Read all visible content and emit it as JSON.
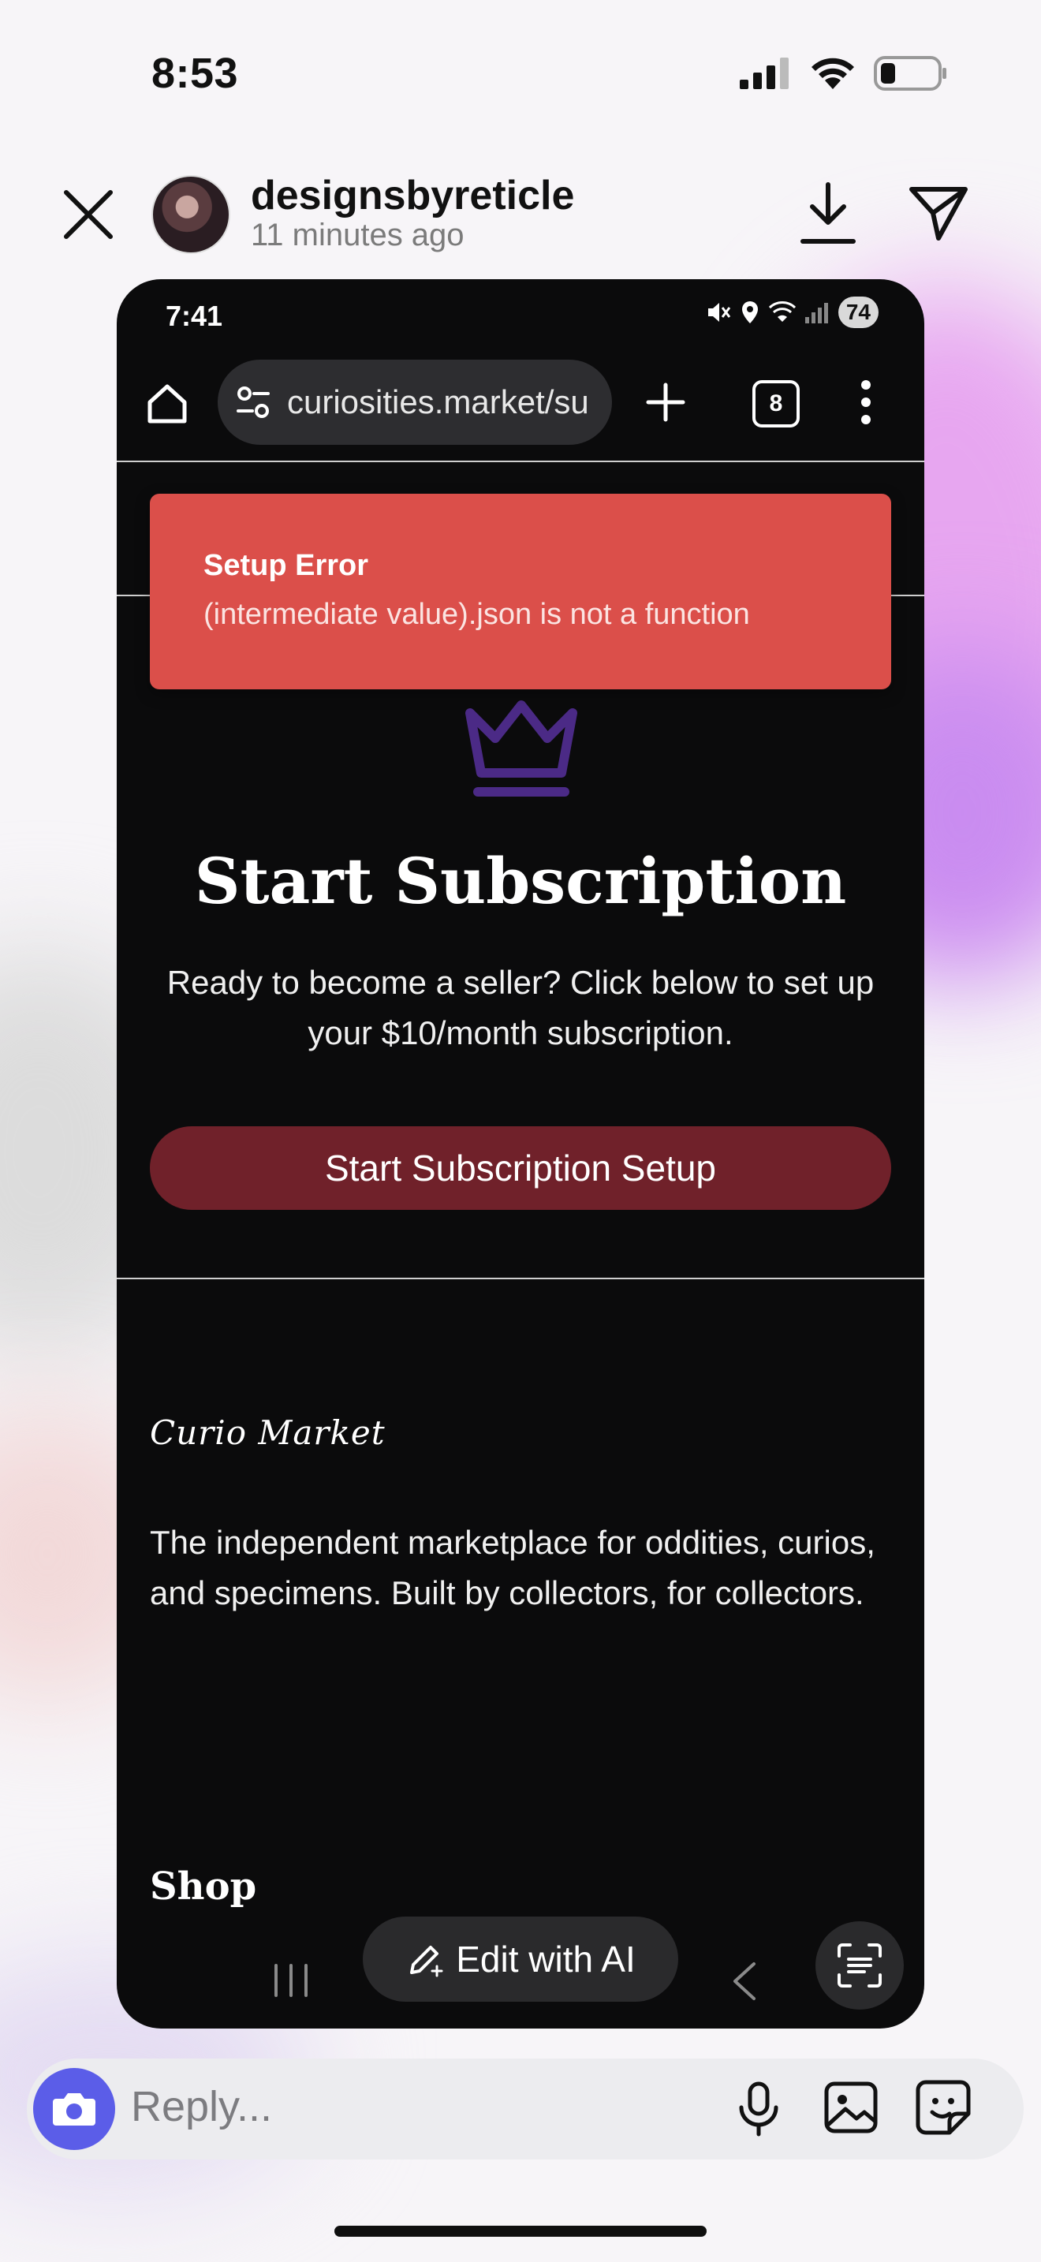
{
  "ios_status": {
    "time": "8:53"
  },
  "story": {
    "username": "designsbyreticle",
    "time_ago": "11 minutes ago"
  },
  "phone": {
    "status_time": "7:41",
    "battery": "74",
    "url": "curiosities.market/su",
    "tab_count": "8",
    "error": {
      "title": "Setup Error",
      "message": "(intermediate value).json is not a function"
    },
    "heading": "Start Subscription",
    "description": "Ready to become a seller? Click below to set up your $10/month subscription.",
    "button_label": "Start Subscription Setup",
    "brand": "Curio Market",
    "footer_text": "The independent marketplace for oddities, curios, and specimens. Built by collectors, for collectors.",
    "shop_heading": "Shop",
    "edit_ai_label": "Edit with AI"
  },
  "reply": {
    "placeholder": "Reply..."
  },
  "colors": {
    "error_bg": "#db4f4a",
    "button_bg": "#70212a",
    "crown": "#4b2a86",
    "camera_bg": "#5b5de8",
    "page_bg": "#0b0b0c"
  },
  "icons": [
    "close-icon",
    "download-icon",
    "send-icon",
    "home-icon",
    "site-settings-icon",
    "plus-icon",
    "tabs-icon",
    "more-vert-icon",
    "crown-icon",
    "pencil-sparkle-icon",
    "recents-icon",
    "back-icon",
    "lens-icon",
    "camera-icon",
    "mic-icon",
    "gallery-icon",
    "sticker-icon"
  ]
}
